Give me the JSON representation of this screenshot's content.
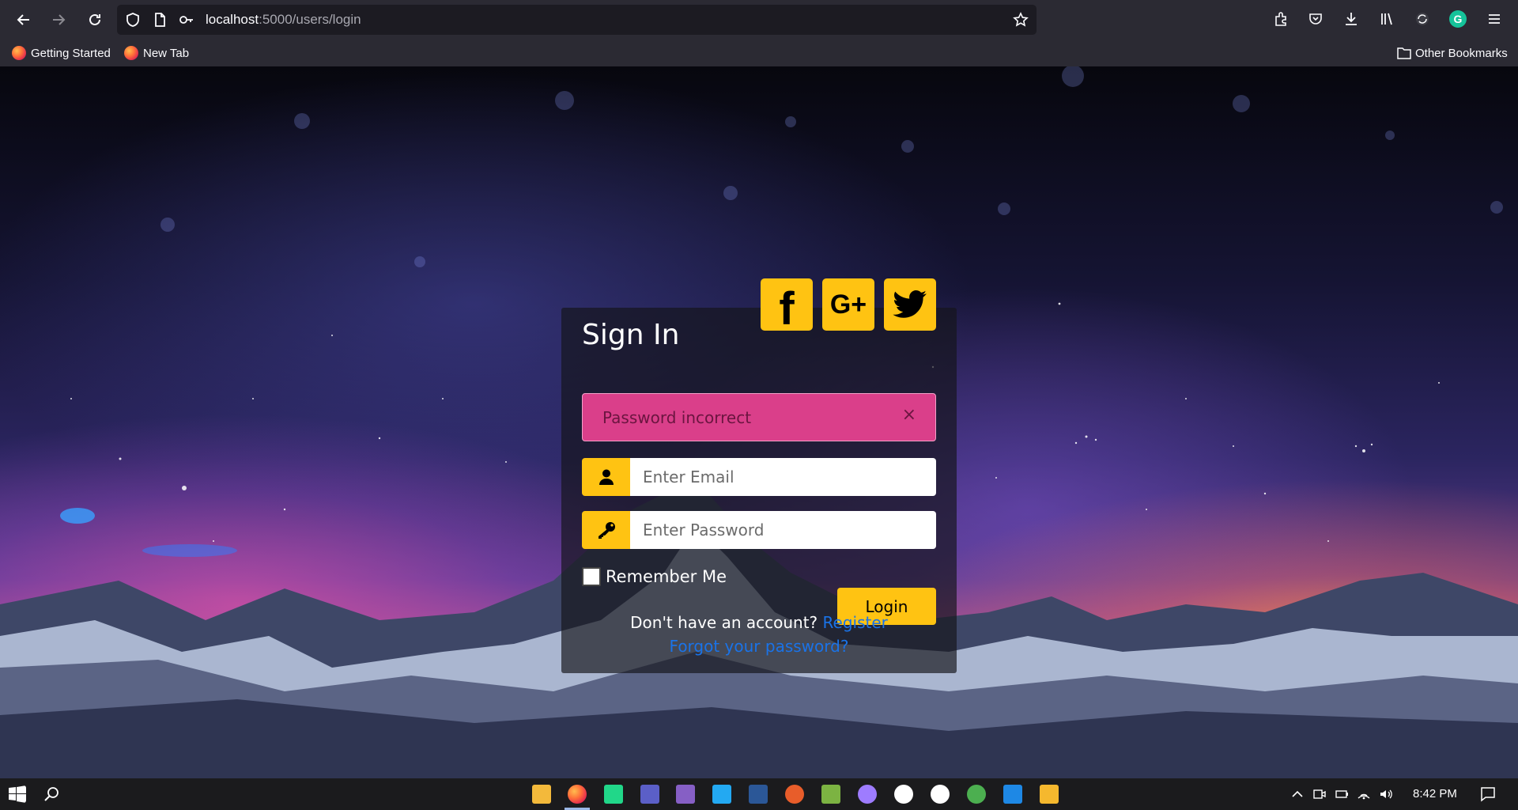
{
  "browser": {
    "url_host": "localhost",
    "url_path": ":5000/users/login",
    "bookmarks": [
      {
        "label": "Getting Started"
      },
      {
        "label": "New Tab"
      }
    ],
    "other_bookmarks": "Other Bookmarks"
  },
  "page": {
    "title": "Sign In",
    "social": {
      "facebook": "f",
      "google": "G+"
    },
    "alert": {
      "text": "Password incorrect",
      "close": "×"
    },
    "email": {
      "placeholder": "Enter Email",
      "value": ""
    },
    "password": {
      "placeholder": "Enter Password",
      "value": ""
    },
    "remember_label": "Remember Me",
    "remember_checked": false,
    "login_label": "Login",
    "no_account_text": "Don't have an account?",
    "register_link": "Register",
    "forgot_link": "Forgot your password?",
    "colors": {
      "accent": "#ffc312",
      "alert_bg": "#da3f8a",
      "link": "#1a73e8"
    }
  },
  "taskbar": {
    "time": "8:42 PM"
  }
}
